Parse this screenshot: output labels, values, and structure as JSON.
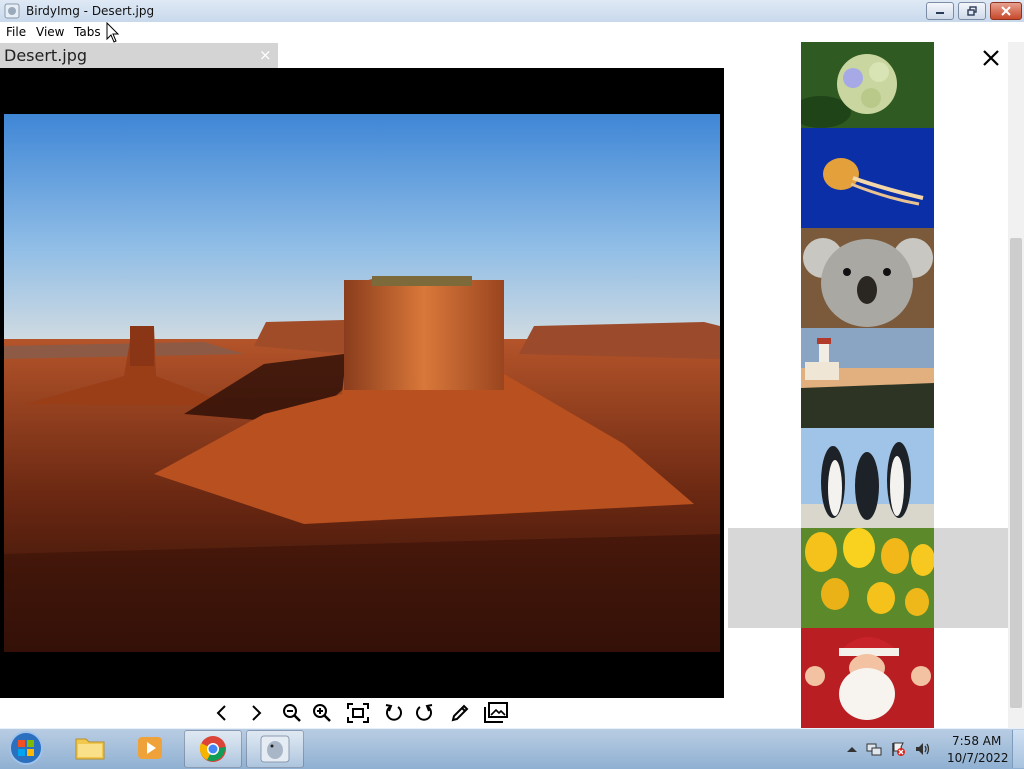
{
  "window": {
    "title": "BirdyImg - Desert.jpg"
  },
  "menu": {
    "file": "File",
    "view": "View",
    "tabs": "Tabs"
  },
  "tab": {
    "title": "Desert.jpg",
    "close": "×"
  },
  "thumbnails": [
    "Hydrangeas",
    "Jellyfish",
    "Koala",
    "Lighthouse",
    "Penguins",
    "Tulips",
    "Santa"
  ],
  "selected_thumbnail": "Tulips",
  "toolbar": [
    "previous-image",
    "next-image",
    "zoom-out",
    "zoom-in",
    "fit-to-window",
    "rotate-left",
    "rotate-right",
    "edit",
    "open-folder"
  ],
  "taskbar": {
    "time": "7:58 AM",
    "date": "10/7/2022"
  },
  "colors": {
    "viewer_bg": "#000000",
    "tab_bg": "#d4d4d4",
    "selected_thumb_bg": "#d7d7d7"
  }
}
